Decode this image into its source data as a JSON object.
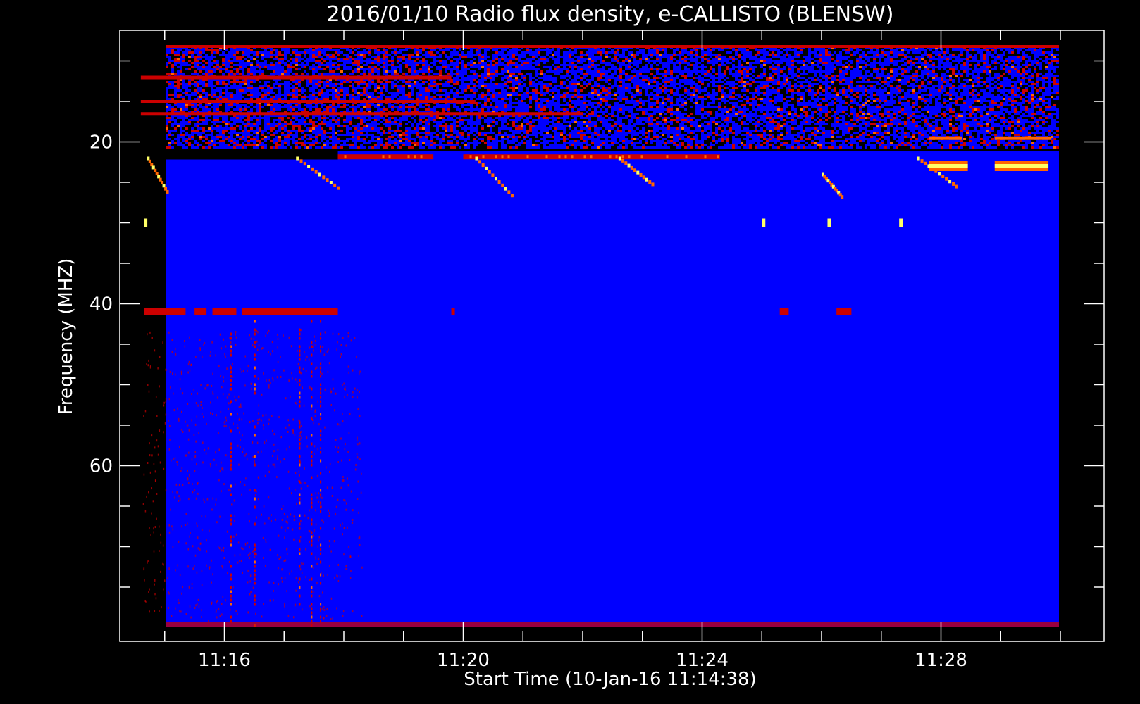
{
  "chart_data": {
    "type": "heatmap",
    "title": "2016/01/10  Radio flux density, e-CALLISTO (BLENSW)",
    "xlabel": "Start Time (10-Jan-16 11:14:38)",
    "ylabel": "Frequency (MHZ)",
    "x_start": "11:14:38",
    "x_end": "11:30:31",
    "x_range_minutes": [
      14.633,
      30.517
    ],
    "y_range_mhz": [
      8,
      80
    ],
    "x_major_ticks": [
      {
        "minute": 16,
        "label": "11:16"
      },
      {
        "minute": 20,
        "label": "11:20"
      },
      {
        "minute": 24,
        "label": "11:24"
      },
      {
        "minute": 28,
        "label": "11:28"
      }
    ],
    "x_minor_tick_minutes": [
      15,
      17,
      18,
      19,
      21,
      22,
      23,
      25,
      26,
      27,
      29,
      30
    ],
    "y_major_ticks": [
      {
        "mhz": 20,
        "label": "20"
      },
      {
        "mhz": 40,
        "label": "40"
      },
      {
        "mhz": 60,
        "label": "60"
      }
    ],
    "y_minor_tick_mhz": [
      10,
      15,
      25,
      30,
      35,
      45,
      50,
      55,
      65,
      70,
      75
    ],
    "colormap": [
      "#000000",
      "#0000ff",
      "#cc0000",
      "#ff6600",
      "#ffff66"
    ],
    "background_color": "#0000ff",
    "features": {
      "noisy_band_mhz": [
        8,
        21
      ],
      "blank_band": {
        "t": [
          14.633,
          17.9
        ],
        "f": [
          21,
          22
        ]
      },
      "bright_band_22mhz": {
        "f": 21.8,
        "segments": [
          [
            17.9,
            19.5
          ],
          [
            20.0,
            24.3
          ]
        ]
      },
      "bright_band_41mhz": {
        "f": 41,
        "segments": [
          [
            14.65,
            15.35
          ],
          [
            15.5,
            15.7
          ],
          [
            15.8,
            16.2
          ],
          [
            16.3,
            17.9
          ],
          [
            25.3,
            25.45
          ],
          [
            26.25,
            26.5
          ]
        ]
      },
      "type3_bursts": [
        {
          "t0": 14.7,
          "t1": 15.05,
          "f0": 22,
          "f1": 26.5
        },
        {
          "t0": 17.2,
          "t1": 17.95,
          "f0": 22,
          "f1": 26
        },
        {
          "t0": 20.2,
          "t1": 20.85,
          "f0": 22,
          "f1": 27
        },
        {
          "t0": 22.6,
          "t1": 23.2,
          "f0": 22,
          "f1": 25.5
        },
        {
          "t0": 26.0,
          "t1": 26.35,
          "f0": 24,
          "f1": 27
        },
        {
          "t0": 27.6,
          "t1": 28.3,
          "f0": 22,
          "f1": 25.8
        }
      ],
      "bright_segments_23mhz": [
        [
          27.8,
          28.45
        ],
        [
          28.9,
          29.8
        ]
      ],
      "bright_segments_19_5mhz": [
        [
          27.8,
          28.35
        ],
        [
          28.9,
          29.85
        ]
      ],
      "vertical_streaks_minutes": [
        17.25,
        17.45,
        17.6,
        16.1,
        16.5
      ]
    }
  }
}
